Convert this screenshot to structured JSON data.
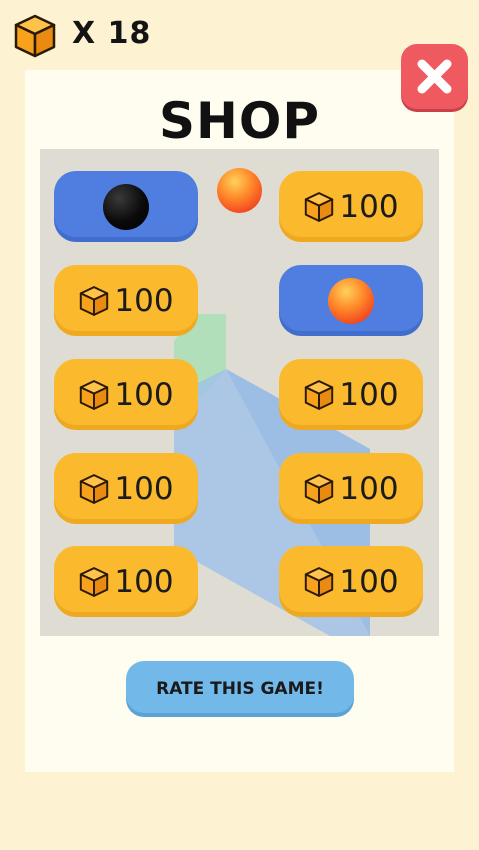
{
  "currency": {
    "icon": "cube-box-icon",
    "count": "X 18"
  },
  "title": "SHOP",
  "close_button": {
    "icon": "close-icon"
  },
  "preview": {
    "icon": "selected-ball-preview"
  },
  "items": [
    {
      "state": "owned",
      "ball": "black"
    },
    {
      "state": "buy",
      "price": "100"
    },
    {
      "state": "buy",
      "price": "100"
    },
    {
      "state": "owned",
      "ball": "orange"
    },
    {
      "state": "buy",
      "price": "100"
    },
    {
      "state": "buy",
      "price": "100"
    },
    {
      "state": "buy",
      "price": "100"
    },
    {
      "state": "buy",
      "price": "100"
    },
    {
      "state": "buy",
      "price": "100"
    },
    {
      "state": "buy",
      "price": "100"
    }
  ],
  "rate_button": {
    "label": "RATE THIS GAME!"
  },
  "colors": {
    "background": "#fdf3d3",
    "panel": "#fffdf0",
    "buy": "#fbb92e",
    "owned": "#4f7ee0",
    "close": "#ee5a60",
    "rate": "#72b9ea"
  }
}
